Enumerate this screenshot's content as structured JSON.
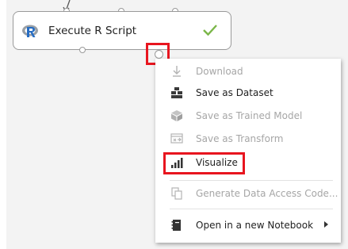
{
  "node": {
    "title": "Execute R Script",
    "status_icon": "check-icon",
    "status_color": "#7ab648",
    "logo_icon": "r-logo-icon",
    "logo_color": "#276dc3"
  },
  "context_menu": {
    "items": [
      {
        "label": "Download",
        "icon": "download-icon",
        "enabled": false
      },
      {
        "label": "Save as Dataset",
        "icon": "dataset-icon",
        "enabled": true
      },
      {
        "label": "Save as Trained Model",
        "icon": "trained-model-icon",
        "enabled": false
      },
      {
        "label": "Save as Transform",
        "icon": "transform-icon",
        "enabled": false
      },
      {
        "label": "Visualize",
        "icon": "bar-chart-icon",
        "enabled": true,
        "highlighted": true
      },
      {
        "label": "Generate Data Access Code...",
        "icon": "code-icon",
        "enabled": false
      },
      {
        "label": "Open in a new Notebook",
        "icon": "notebook-icon",
        "enabled": true,
        "has_submenu": true
      }
    ]
  },
  "colors": {
    "highlight": "#e8151f",
    "canvas": "#f3f3f3",
    "disabled_text": "#a6a6a6"
  }
}
